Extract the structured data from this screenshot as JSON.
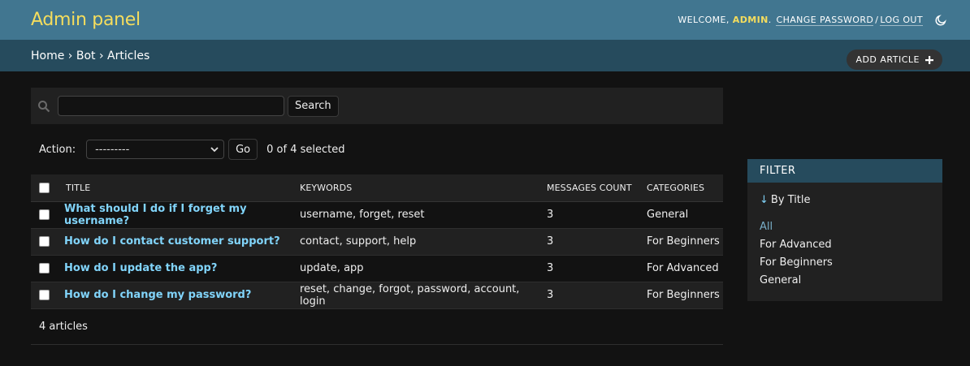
{
  "header": {
    "branding": "Admin panel",
    "welcome": "Welcome,",
    "user": "admin",
    "change_password": "Change password",
    "separator": "/",
    "logout": "Log out",
    "theme_icon": "moon-icon"
  },
  "breadcrumbs": {
    "home": "Home",
    "app": "Bot",
    "current": "Articles",
    "sep": "›"
  },
  "add_button": {
    "label": "Add article",
    "icon": "plus-icon"
  },
  "toolbar": {
    "search_icon": "search-icon",
    "search_value": "",
    "search_button": "Search"
  },
  "actions": {
    "label": "Action:",
    "selected_option": "---------",
    "go_button": "Go",
    "counter": "0 of 4 selected"
  },
  "table": {
    "headers": {
      "title": "Title",
      "keywords": "Keywords",
      "messages_count": "Messages count",
      "categories": "Categories"
    },
    "rows": [
      {
        "title": "What should I do if I forget my username?",
        "keywords": "username, forget, reset",
        "messages_count": "3",
        "categories": "General"
      },
      {
        "title": "How do I contact customer support?",
        "keywords": "contact, support, help",
        "messages_count": "3",
        "categories": "For Beginners"
      },
      {
        "title": "How do I update the app?",
        "keywords": "update, app",
        "messages_count": "3",
        "categories": "For Advanced"
      },
      {
        "title": "How do I change my password?",
        "keywords": "reset, change, forgot, password, account, login",
        "messages_count": "3",
        "categories": "For Beginners"
      }
    ]
  },
  "paginator": {
    "text": "4 articles"
  },
  "filter": {
    "heading": "Filter",
    "section_arrow": "↓",
    "section_title": "By Title",
    "options": [
      "All",
      "For Advanced",
      "For Beginners",
      "General"
    ],
    "selected_option": "All"
  },
  "colors": {
    "header_bg": "#417690",
    "breadcrumb_bg": "#264b5d",
    "branding": "#f5dd5d",
    "link": "#81d4fa",
    "page_bg": "#121212"
  }
}
